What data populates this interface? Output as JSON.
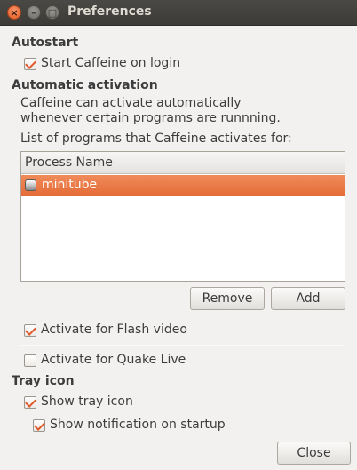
{
  "window": {
    "title": "Preferences",
    "close_glyph": "×",
    "minimize_glyph": "–",
    "maximize_glyph": "□"
  },
  "autostart": {
    "heading": "Autostart",
    "start_on_login": {
      "label": "Start Caffeine on login",
      "checked": true
    }
  },
  "automatic_activation": {
    "heading": "Automatic activation",
    "description_line1": "Caffeine can activate automatically",
    "description_line2": "whenever certain programs are runnning.",
    "list_caption": "List of programs that Caffeine activates for:",
    "list": {
      "column_header": "Process Name",
      "rows": [
        {
          "name": "minitube",
          "selected": true
        }
      ]
    },
    "remove_label": "Remove",
    "add_label": "Add",
    "flash_video": {
      "label": "Activate for Flash video",
      "checked": true
    },
    "quake_live": {
      "label": "Activate for Quake Live",
      "checked": false
    }
  },
  "tray_icon": {
    "heading": "Tray icon",
    "show_tray_icon": {
      "label": "Show tray icon",
      "checked": true
    },
    "show_notification": {
      "label": "Show notification on startup",
      "checked": true
    }
  },
  "close_label": "Close",
  "colors": {
    "accent": "#e46b36",
    "titlebar": "#3c3b37",
    "window_bg": "#f2f1f0"
  }
}
